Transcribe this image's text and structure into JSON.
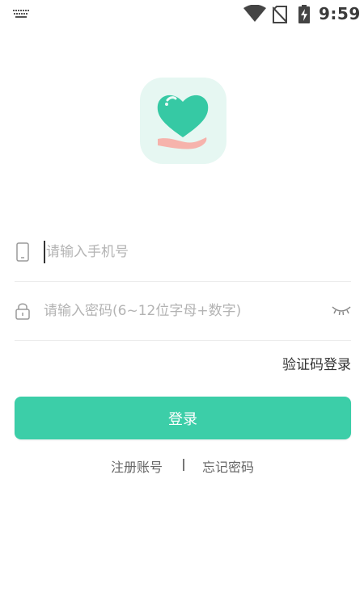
{
  "status_bar": {
    "time": "9:59",
    "icons": [
      "keyboard-icon",
      "wifi-icon",
      "no-sim-icon",
      "battery-charging-icon"
    ]
  },
  "logo": {
    "icon": "heart-hand-logo",
    "colors": {
      "heart": "#36c9a4",
      "hand": "#f6b3ac",
      "background": "#e6f7f2"
    }
  },
  "form": {
    "phone": {
      "placeholder": "请输入手机号",
      "value": "",
      "icon": "phone-icon"
    },
    "password": {
      "placeholder": "请输入密码(6~12位字母+数字)",
      "value": "",
      "icon": "lock-icon",
      "toggle_icon": "eye-closed-icon"
    }
  },
  "sms_login_label": "验证码登录",
  "login_button": {
    "label": "登录",
    "color": "#3ccea8"
  },
  "footer_links": {
    "register": "注册账号",
    "separator": "|",
    "forgot": "忘记密码"
  }
}
